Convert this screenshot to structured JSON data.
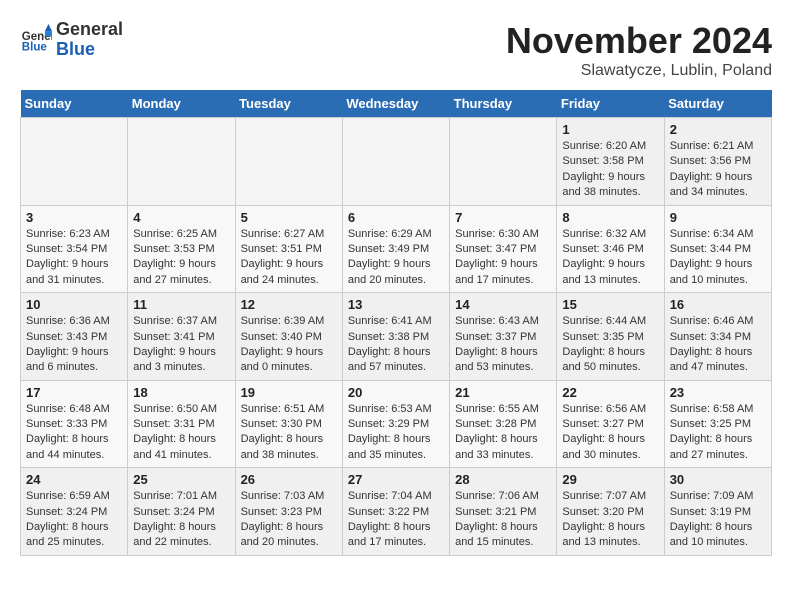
{
  "logo": {
    "general": "General",
    "blue": "Blue"
  },
  "title": "November 2024",
  "location": "Slawatycze, Lublin, Poland",
  "weekdays": [
    "Sunday",
    "Monday",
    "Tuesday",
    "Wednesday",
    "Thursday",
    "Friday",
    "Saturday"
  ],
  "weeks": [
    [
      {
        "day": "",
        "info": "",
        "empty": true
      },
      {
        "day": "",
        "info": "",
        "empty": true
      },
      {
        "day": "",
        "info": "",
        "empty": true
      },
      {
        "day": "",
        "info": "",
        "empty": true
      },
      {
        "day": "",
        "info": "",
        "empty": true
      },
      {
        "day": "1",
        "info": "Sunrise: 6:20 AM\nSunset: 3:58 PM\nDaylight: 9 hours\nand 38 minutes."
      },
      {
        "day": "2",
        "info": "Sunrise: 6:21 AM\nSunset: 3:56 PM\nDaylight: 9 hours\nand 34 minutes."
      }
    ],
    [
      {
        "day": "3",
        "info": "Sunrise: 6:23 AM\nSunset: 3:54 PM\nDaylight: 9 hours\nand 31 minutes."
      },
      {
        "day": "4",
        "info": "Sunrise: 6:25 AM\nSunset: 3:53 PM\nDaylight: 9 hours\nand 27 minutes."
      },
      {
        "day": "5",
        "info": "Sunrise: 6:27 AM\nSunset: 3:51 PM\nDaylight: 9 hours\nand 24 minutes."
      },
      {
        "day": "6",
        "info": "Sunrise: 6:29 AM\nSunset: 3:49 PM\nDaylight: 9 hours\nand 20 minutes."
      },
      {
        "day": "7",
        "info": "Sunrise: 6:30 AM\nSunset: 3:47 PM\nDaylight: 9 hours\nand 17 minutes."
      },
      {
        "day": "8",
        "info": "Sunrise: 6:32 AM\nSunset: 3:46 PM\nDaylight: 9 hours\nand 13 minutes."
      },
      {
        "day": "9",
        "info": "Sunrise: 6:34 AM\nSunset: 3:44 PM\nDaylight: 9 hours\nand 10 minutes."
      }
    ],
    [
      {
        "day": "10",
        "info": "Sunrise: 6:36 AM\nSunset: 3:43 PM\nDaylight: 9 hours\nand 6 minutes."
      },
      {
        "day": "11",
        "info": "Sunrise: 6:37 AM\nSunset: 3:41 PM\nDaylight: 9 hours\nand 3 minutes."
      },
      {
        "day": "12",
        "info": "Sunrise: 6:39 AM\nSunset: 3:40 PM\nDaylight: 9 hours\nand 0 minutes."
      },
      {
        "day": "13",
        "info": "Sunrise: 6:41 AM\nSunset: 3:38 PM\nDaylight: 8 hours\nand 57 minutes."
      },
      {
        "day": "14",
        "info": "Sunrise: 6:43 AM\nSunset: 3:37 PM\nDaylight: 8 hours\nand 53 minutes."
      },
      {
        "day": "15",
        "info": "Sunrise: 6:44 AM\nSunset: 3:35 PM\nDaylight: 8 hours\nand 50 minutes."
      },
      {
        "day": "16",
        "info": "Sunrise: 6:46 AM\nSunset: 3:34 PM\nDaylight: 8 hours\nand 47 minutes."
      }
    ],
    [
      {
        "day": "17",
        "info": "Sunrise: 6:48 AM\nSunset: 3:33 PM\nDaylight: 8 hours\nand 44 minutes."
      },
      {
        "day": "18",
        "info": "Sunrise: 6:50 AM\nSunset: 3:31 PM\nDaylight: 8 hours\nand 41 minutes."
      },
      {
        "day": "19",
        "info": "Sunrise: 6:51 AM\nSunset: 3:30 PM\nDaylight: 8 hours\nand 38 minutes."
      },
      {
        "day": "20",
        "info": "Sunrise: 6:53 AM\nSunset: 3:29 PM\nDaylight: 8 hours\nand 35 minutes."
      },
      {
        "day": "21",
        "info": "Sunrise: 6:55 AM\nSunset: 3:28 PM\nDaylight: 8 hours\nand 33 minutes."
      },
      {
        "day": "22",
        "info": "Sunrise: 6:56 AM\nSunset: 3:27 PM\nDaylight: 8 hours\nand 30 minutes."
      },
      {
        "day": "23",
        "info": "Sunrise: 6:58 AM\nSunset: 3:25 PM\nDaylight: 8 hours\nand 27 minutes."
      }
    ],
    [
      {
        "day": "24",
        "info": "Sunrise: 6:59 AM\nSunset: 3:24 PM\nDaylight: 8 hours\nand 25 minutes."
      },
      {
        "day": "25",
        "info": "Sunrise: 7:01 AM\nSunset: 3:24 PM\nDaylight: 8 hours\nand 22 minutes."
      },
      {
        "day": "26",
        "info": "Sunrise: 7:03 AM\nSunset: 3:23 PM\nDaylight: 8 hours\nand 20 minutes."
      },
      {
        "day": "27",
        "info": "Sunrise: 7:04 AM\nSunset: 3:22 PM\nDaylight: 8 hours\nand 17 minutes."
      },
      {
        "day": "28",
        "info": "Sunrise: 7:06 AM\nSunset: 3:21 PM\nDaylight: 8 hours\nand 15 minutes."
      },
      {
        "day": "29",
        "info": "Sunrise: 7:07 AM\nSunset: 3:20 PM\nDaylight: 8 hours\nand 13 minutes."
      },
      {
        "day": "30",
        "info": "Sunrise: 7:09 AM\nSunset: 3:19 PM\nDaylight: 8 hours\nand 10 minutes."
      }
    ]
  ]
}
